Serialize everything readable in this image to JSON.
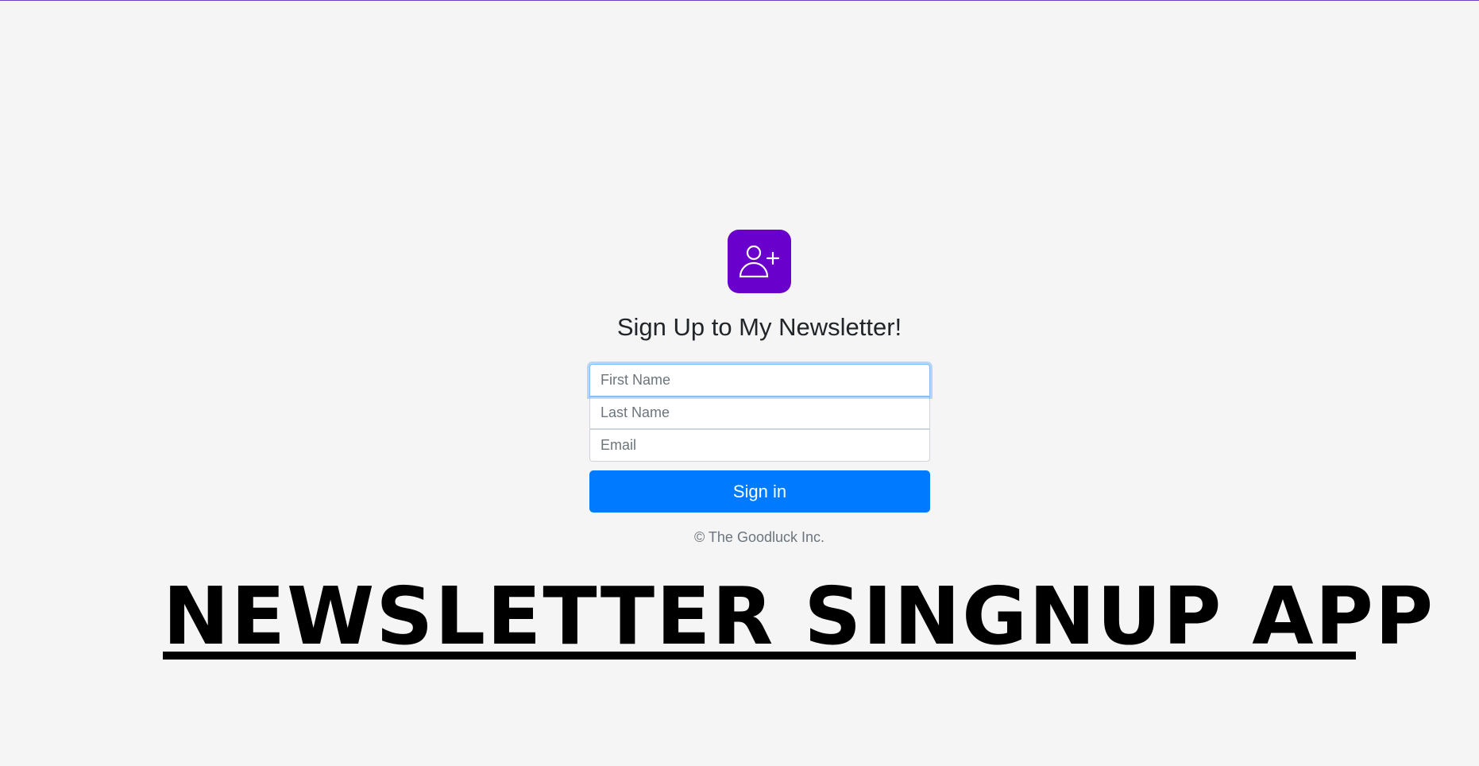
{
  "form": {
    "title": "Sign Up to My Newsletter!",
    "first_name_placeholder": "First Name",
    "last_name_placeholder": "Last Name",
    "email_placeholder": "Email",
    "submit_label": "Sign in",
    "footer": "© The Goodluck Inc."
  },
  "banner": {
    "text": "NEWSLETTER SINGNUP APP"
  },
  "icons": {
    "logo": "add-user-icon"
  },
  "colors": {
    "accent_purple": "#6a00cc",
    "button_blue": "#007bff",
    "background": "#f5f5f5"
  }
}
